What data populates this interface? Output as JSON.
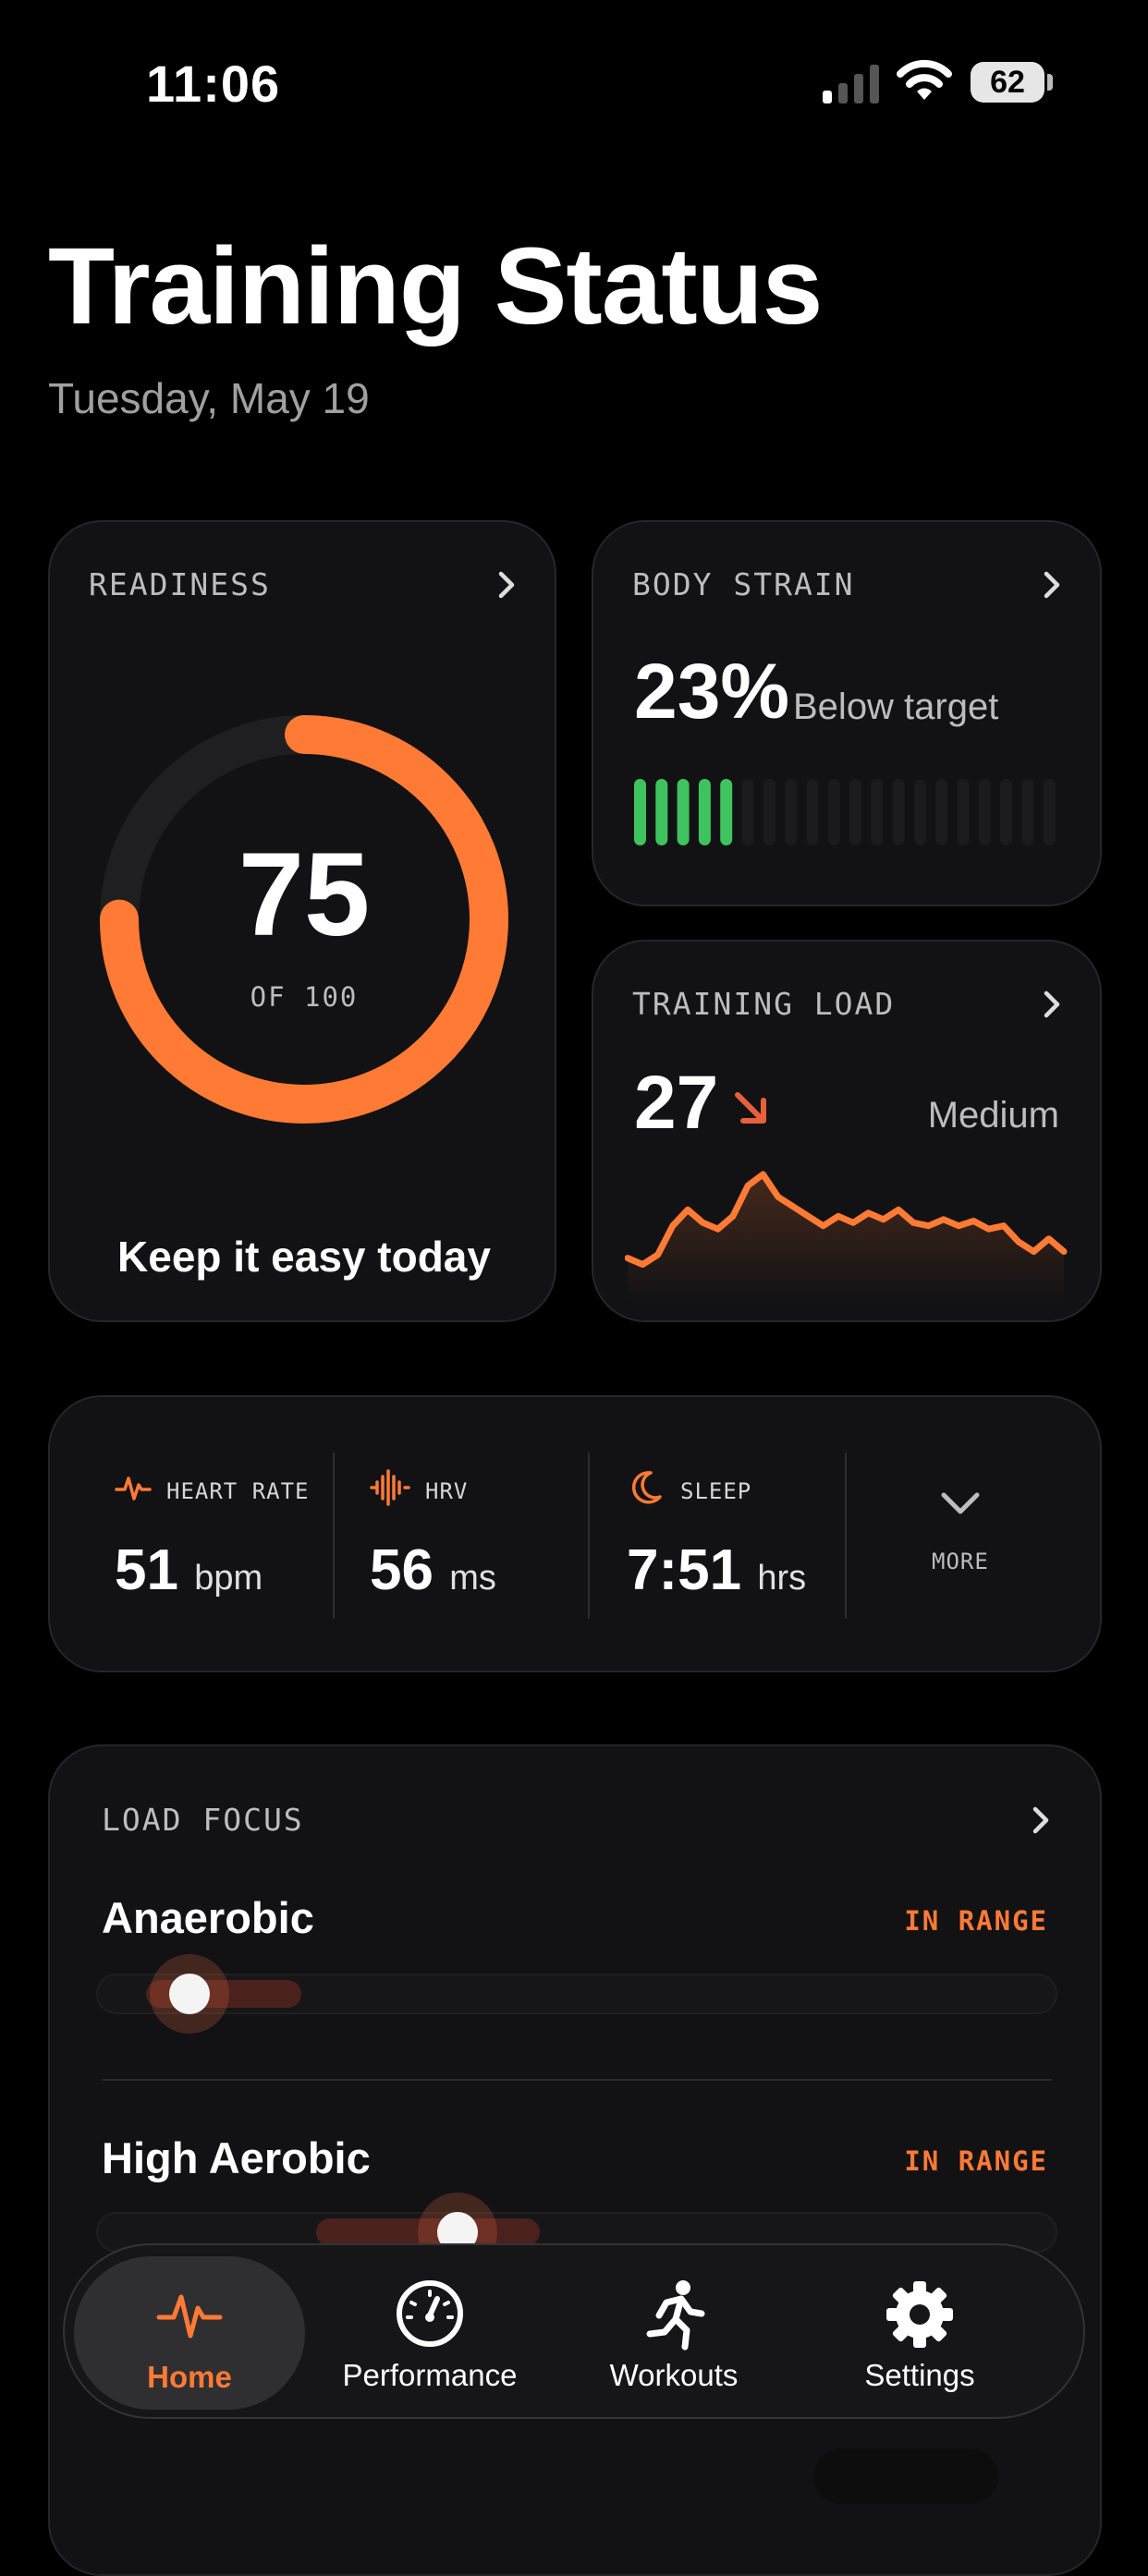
{
  "status_bar": {
    "time": "11:06",
    "battery": "62"
  },
  "header": {
    "title": "Training Status",
    "date": "Tuesday, May 19"
  },
  "readiness": {
    "label": "READINESS",
    "value": "75",
    "of": "OF 100",
    "fraction": 0.75,
    "message": "Keep it easy today"
  },
  "body_strain": {
    "label": "BODY STRAIN",
    "percent": "23%",
    "description": "Below target",
    "bars_active": 5,
    "bars_total": 20
  },
  "training_load": {
    "label": "TRAINING LOAD",
    "value": "27",
    "level": "Medium",
    "trend": [
      10,
      6,
      12,
      30,
      40,
      32,
      28,
      36,
      55,
      62,
      48,
      42,
      36,
      30,
      36,
      32,
      38,
      34,
      40,
      32,
      30,
      34,
      30,
      33,
      28,
      30,
      20,
      14,
      22,
      14
    ]
  },
  "metrics": [
    {
      "label": "HEART RATE",
      "value": "51",
      "unit": "bpm"
    },
    {
      "label": "HRV",
      "value": "56",
      "unit": "ms"
    },
    {
      "label": "SLEEP",
      "value": "7:51",
      "unit": "hrs"
    }
  ],
  "more_label": "MORE",
  "load_focus": {
    "label": "LOAD FOCUS",
    "items": [
      {
        "name": "Anaerobic",
        "status": "IN RANGE"
      },
      {
        "name": "High Aerobic",
        "status": "IN RANGE"
      }
    ]
  },
  "tabs": [
    {
      "label": "Home",
      "icon": "pulse-icon"
    },
    {
      "label": "Performance",
      "icon": "gauge-icon"
    },
    {
      "label": "Workouts",
      "icon": "runner-icon"
    },
    {
      "label": "Settings",
      "icon": "gear-icon"
    }
  ],
  "colors": {
    "accent": "#ff7a35",
    "strain_active": "#3fc35e",
    "background": "#000000",
    "card": "#121214"
  }
}
